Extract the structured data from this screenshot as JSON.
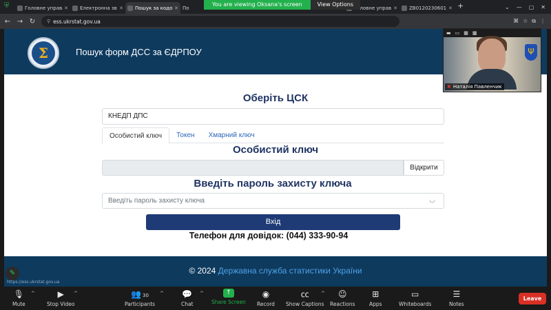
{
  "browser": {
    "tabs": [
      {
        "title": "Головне управл"
      },
      {
        "title": "Електронна зв"
      },
      {
        "title": "Пошук за кодо"
      },
      {
        "title": "По"
      },
      {
        "title": "Головне управ"
      },
      {
        "title": "ZB01202306011"
      }
    ],
    "url": "ess.ukrstat.gov.ua"
  },
  "share_banner": {
    "message": "You are viewing Oksana's screen",
    "options_label": "View Options"
  },
  "site": {
    "header_title": "Пошук форм ДСС за ЄДРПОУ",
    "choose_csk_title": "Оберіть ЦСК",
    "csk_selected": "КНЕДП ДПС",
    "tabs": [
      {
        "label": "Особистий ключ"
      },
      {
        "label": "Токен"
      },
      {
        "label": "Хмарний ключ"
      }
    ],
    "key_section_title": "Особистий ключ",
    "open_button": "Відкрити",
    "password_title": "Введіть пароль захисту ключа",
    "password_placeholder": "Введіть пароль захисту ключа",
    "login_button": "Вхід",
    "phone_text": "Телефон для довідок: (044) 333-90-94",
    "footer_prefix": "© 2024",
    "footer_agency": "Державна служба статистики України",
    "status_url": "https://ess.ukrstat.gov.ua"
  },
  "video": {
    "participant_name": "Наталія Павленчик"
  },
  "zoom_toolbar": {
    "mute": "Mute",
    "stop_video": "Stop Video",
    "participants": "Participants",
    "participants_count": "30",
    "chat": "Chat",
    "share_screen": "Share Screen",
    "record": "Record",
    "show_captions": "Show Captions",
    "reactions": "Reactions",
    "apps": "Apps",
    "whiteboards": "Whiteboards",
    "notes": "Notes",
    "leave": "Leave"
  },
  "colors": {
    "header_bg": "#0e3a5e",
    "heading": "#1f3463",
    "login_button": "#1f3b75",
    "share_green": "#23b14d",
    "leave_red": "#d93025"
  }
}
